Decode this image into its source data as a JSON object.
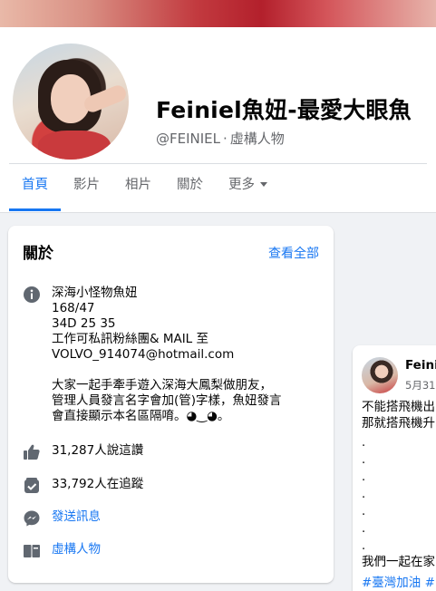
{
  "page": {
    "name": "Feiniel魚妞-最愛大眼魚",
    "handle": "@FEINIEL",
    "separator": "·",
    "category": "虛構人物"
  },
  "tabs": [
    {
      "label": "首頁",
      "active": true
    },
    {
      "label": "影片",
      "active": false
    },
    {
      "label": "相片",
      "active": false
    },
    {
      "label": "關於",
      "active": false
    },
    {
      "label": "更多",
      "active": false
    }
  ],
  "about": {
    "title": "關於",
    "see_all": "查看全部",
    "intro_lines": [
      "深海小怪物魚妞",
      "168/47",
      "34D 25 35",
      "工作可私訊粉絲團& MAIL 至",
      "VOLVO_914074@hotmail.com"
    ],
    "description_lines": [
      "大家一起手牽手遊入深海大鳳梨做朋友，",
      "管理人員發言名字會加(管)字樣，魚妞發言",
      "會直接顯示本名區隔唷。◕‿◕。"
    ],
    "likes": "31,287人說這讚",
    "followers": "33,792人在追蹤",
    "message": "發送訊息",
    "category": "虛構人物"
  },
  "post": {
    "author": "Feiniel",
    "date": "5月31",
    "line1": "不能搭飛機出",
    "line2": "那就搭飛機升",
    "dots": [
      ".",
      ".",
      ".",
      ".",
      ".",
      ".",
      "."
    ],
    "line3": "我們一起在家",
    "hashtags": "#臺灣加油 #"
  },
  "colors": {
    "accent": "#1877f2",
    "secondary_text": "#65676b",
    "icon_gray": "#606770"
  }
}
